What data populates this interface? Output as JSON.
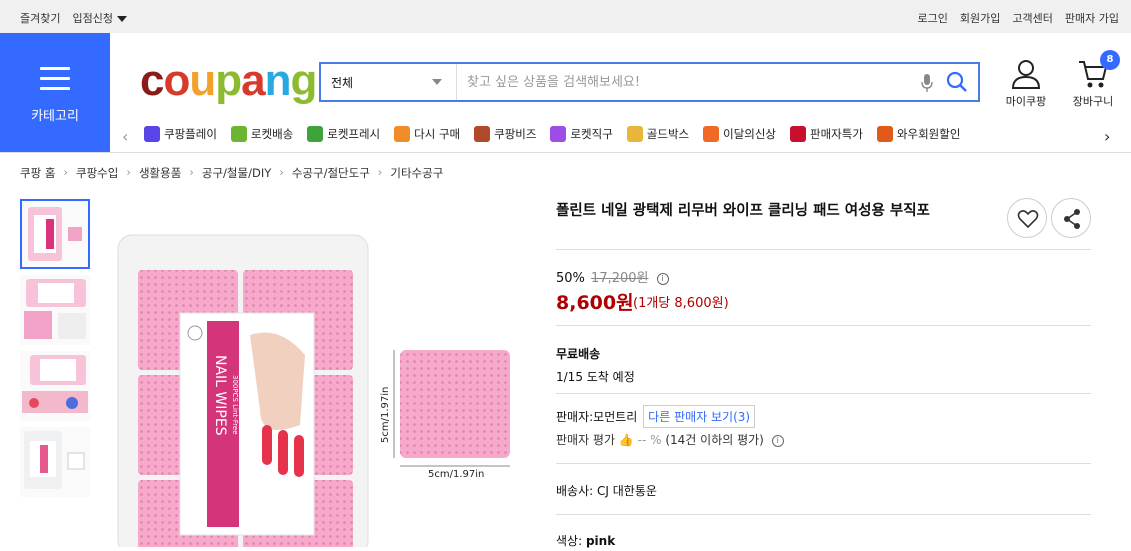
{
  "topbar": {
    "left": [
      "즐겨찾기",
      "입점신청"
    ],
    "right": [
      "로그인",
      "회원가입",
      "고객센터",
      "판매자 가입"
    ]
  },
  "header": {
    "category_label": "카테고리",
    "logo_text": "coupang",
    "search": {
      "select_value": "전체",
      "placeholder": "찾고 싶은 상품을 검색해보세요!"
    },
    "mycoupang_label": "마이쿠팡",
    "cart_label": "장바구니",
    "cart_count": "8"
  },
  "quicklinks": [
    {
      "label": "쿠팡플레이",
      "icon": "play-icon",
      "color": "#5a46e8"
    },
    {
      "label": "로켓배송",
      "icon": "rocket-icon",
      "color": "#6bb532"
    },
    {
      "label": "로켓프레시",
      "icon": "rocket-fresh-icon",
      "color": "#3fa33b"
    },
    {
      "label": "다시 구매",
      "icon": "rebuy-icon",
      "color": "#f28c28"
    },
    {
      "label": "쿠팡비즈",
      "icon": "biz-icon",
      "color": "#b04a2a"
    },
    {
      "label": "로켓직구",
      "icon": "global-icon",
      "color": "#9c4de6"
    },
    {
      "label": "골드박스",
      "icon": "goldbox-icon",
      "color": "#e9b63b"
    },
    {
      "label": "이달의신상",
      "icon": "new-icon",
      "color": "#f06a24"
    },
    {
      "label": "판매자특가",
      "icon": "percent-icon",
      "color": "#c8102e"
    },
    {
      "label": "와우회원할인",
      "icon": "wow-icon",
      "color": "#e05a1a"
    }
  ],
  "breadcrumbs": [
    "쿠팡 홈",
    "쿠팡수입",
    "생활용품",
    "공구/철물/DIY",
    "수공구/절단도구",
    "기타수공구"
  ],
  "product": {
    "title": "폴린트 네일 광택제 리무버 와이프 클리닝 패드 여성용 부직포",
    "discount_rate": "50%",
    "original_price": "17,200원",
    "price": "8,600원",
    "unit_price": "(1개당 8,600원)",
    "shipping_label": "무료배송",
    "arrival": "1/15 도착 예정",
    "seller_label": "판매자:",
    "seller_name": "모먼트리",
    "other_sellers": "다른 판매자 보기(3)",
    "seller_rating_label": "판매자 평가",
    "seller_rating_value": "-- %",
    "seller_rating_note": "(14건 이하의 평가)",
    "carrier_label": "배송사:",
    "carrier_name": "CJ 대한통운",
    "color_label": "색상:",
    "color_value": "pink"
  },
  "image_text": {
    "package_line1": "NAIL WIPES",
    "package_line2": "300PCS Lint-Free",
    "dim_width": "5cm/1.97in",
    "dim_height": "5cm/1.97in"
  },
  "colors": {
    "brand_blue": "#346aff",
    "price_red": "#ae0000",
    "pad_pink": "#f2a2c6"
  }
}
